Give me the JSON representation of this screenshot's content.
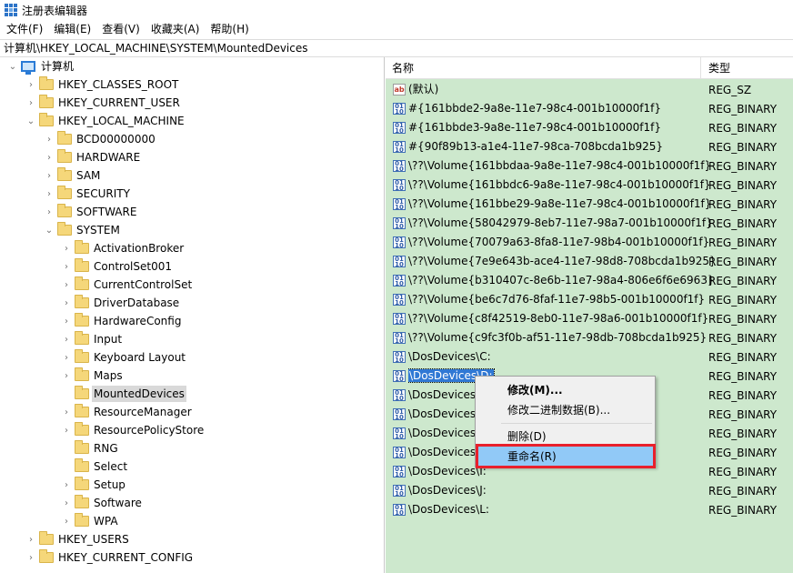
{
  "window": {
    "title": "注册表编辑器"
  },
  "menu": [
    "文件(F)",
    "编辑(E)",
    "查看(V)",
    "收藏夹(A)",
    "帮助(H)"
  ],
  "address": "计算机\\HKEY_LOCAL_MACHINE\\SYSTEM\\MountedDevices",
  "tree": [
    {
      "label": "计算机",
      "level": 0,
      "expander": "open",
      "icon": "computer"
    },
    {
      "label": "HKEY_CLASSES_ROOT",
      "level": 1,
      "expander": "closed"
    },
    {
      "label": "HKEY_CURRENT_USER",
      "level": 1,
      "expander": "closed"
    },
    {
      "label": "HKEY_LOCAL_MACHINE",
      "level": 1,
      "expander": "open"
    },
    {
      "label": "BCD00000000",
      "level": 2,
      "expander": "closed"
    },
    {
      "label": "HARDWARE",
      "level": 2,
      "expander": "closed"
    },
    {
      "label": "SAM",
      "level": 2,
      "expander": "closed"
    },
    {
      "label": "SECURITY",
      "level": 2,
      "expander": "closed"
    },
    {
      "label": "SOFTWARE",
      "level": 2,
      "expander": "closed"
    },
    {
      "label": "SYSTEM",
      "level": 2,
      "expander": "open"
    },
    {
      "label": "ActivationBroker",
      "level": 3,
      "expander": "closed"
    },
    {
      "label": "ControlSet001",
      "level": 3,
      "expander": "closed"
    },
    {
      "label": "CurrentControlSet",
      "level": 3,
      "expander": "closed"
    },
    {
      "label": "DriverDatabase",
      "level": 3,
      "expander": "closed"
    },
    {
      "label": "HardwareConfig",
      "level": 3,
      "expander": "closed"
    },
    {
      "label": "Input",
      "level": 3,
      "expander": "closed"
    },
    {
      "label": "Keyboard Layout",
      "level": 3,
      "expander": "closed"
    },
    {
      "label": "Maps",
      "level": 3,
      "expander": "closed"
    },
    {
      "label": "MountedDevices",
      "level": 3,
      "expander": "none",
      "selected": true
    },
    {
      "label": "ResourceManager",
      "level": 3,
      "expander": "closed"
    },
    {
      "label": "ResourcePolicyStore",
      "level": 3,
      "expander": "closed"
    },
    {
      "label": "RNG",
      "level": 3,
      "expander": "none"
    },
    {
      "label": "Select",
      "level": 3,
      "expander": "none"
    },
    {
      "label": "Setup",
      "level": 3,
      "expander": "closed"
    },
    {
      "label": "Software",
      "level": 3,
      "expander": "closed"
    },
    {
      "label": "WPA",
      "level": 3,
      "expander": "closed"
    },
    {
      "label": "HKEY_USERS",
      "level": 1,
      "expander": "closed"
    },
    {
      "label": "HKEY_CURRENT_CONFIG",
      "level": 1,
      "expander": "closed"
    }
  ],
  "list_header": {
    "name": "名称",
    "type": "类型"
  },
  "values": [
    {
      "name": "(默认)",
      "type": "REG_SZ",
      "icon": "string"
    },
    {
      "name": "#{161bbde2-9a8e-11e7-98c4-001b10000f1f}",
      "type": "REG_BINARY",
      "icon": "binary"
    },
    {
      "name": "#{161bbde3-9a8e-11e7-98c4-001b10000f1f}",
      "type": "REG_BINARY",
      "icon": "binary"
    },
    {
      "name": "#{90f89b13-a1e4-11e7-98ca-708bcda1b925}",
      "type": "REG_BINARY",
      "icon": "binary"
    },
    {
      "name": "\\??\\Volume{161bbdaa-9a8e-11e7-98c4-001b10000f1f}",
      "type": "REG_BINARY",
      "icon": "binary"
    },
    {
      "name": "\\??\\Volume{161bbdc6-9a8e-11e7-98c4-001b10000f1f}",
      "type": "REG_BINARY",
      "icon": "binary"
    },
    {
      "name": "\\??\\Volume{161bbe29-9a8e-11e7-98c4-001b10000f1f}",
      "type": "REG_BINARY",
      "icon": "binary"
    },
    {
      "name": "\\??\\Volume{58042979-8eb7-11e7-98a7-001b10000f1f}",
      "type": "REG_BINARY",
      "icon": "binary"
    },
    {
      "name": "\\??\\Volume{70079a63-8fa8-11e7-98b4-001b10000f1f}",
      "type": "REG_BINARY",
      "icon": "binary"
    },
    {
      "name": "\\??\\Volume{7e9e643b-ace4-11e7-98d8-708bcda1b925}",
      "type": "REG_BINARY",
      "icon": "binary"
    },
    {
      "name": "\\??\\Volume{b310407c-8e6b-11e7-98a4-806e6f6e6963}",
      "type": "REG_BINARY",
      "icon": "binary"
    },
    {
      "name": "\\??\\Volume{be6c7d76-8faf-11e7-98b5-001b10000f1f}",
      "type": "REG_BINARY",
      "icon": "binary"
    },
    {
      "name": "\\??\\Volume{c8f42519-8eb0-11e7-98a6-001b10000f1f}",
      "type": "REG_BINARY",
      "icon": "binary"
    },
    {
      "name": "\\??\\Volume{c9fc3f0b-af51-11e7-98db-708bcda1b925}",
      "type": "REG_BINARY",
      "icon": "binary"
    },
    {
      "name": "\\DosDevices\\C:",
      "type": "REG_BINARY",
      "icon": "binary"
    },
    {
      "name": "\\DosDevices\\D:",
      "type": "REG_BINARY",
      "icon": "binary",
      "focused": true
    },
    {
      "name": "\\DosDevices\\",
      "type": "REG_BINARY",
      "icon": "binary"
    },
    {
      "name": "\\DosDevices\\",
      "type": "REG_BINARY",
      "icon": "binary"
    },
    {
      "name": "\\DosDevices\\",
      "type": "REG_BINARY",
      "icon": "binary"
    },
    {
      "name": "\\DosDevices\\",
      "type": "REG_BINARY",
      "icon": "binary"
    },
    {
      "name": "\\DosDevices\\I:",
      "type": "REG_BINARY",
      "icon": "binary"
    },
    {
      "name": "\\DosDevices\\J:",
      "type": "REG_BINARY",
      "icon": "binary"
    },
    {
      "name": "\\DosDevices\\L:",
      "type": "REG_BINARY",
      "icon": "binary"
    }
  ],
  "context_menu": {
    "modify": "修改(M)...",
    "modify_binary": "修改二进制数据(B)...",
    "delete": "删除(D)",
    "rename": "重命名(R)"
  },
  "colors": {
    "list_background": "#cde8cd",
    "selection": "#3078d4",
    "menu_hover": "#91c9f7",
    "highlight_box": "#e8202c"
  }
}
